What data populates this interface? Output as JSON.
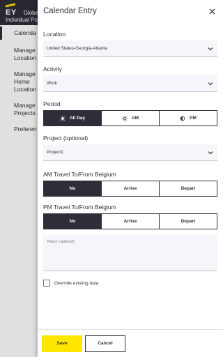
{
  "background": {
    "logo": "EY",
    "app_title": "Global",
    "subtitle": "Individual Po",
    "nav": [
      {
        "label": "Calenda",
        "active": true
      },
      {
        "label": "Manage Location",
        "active": false
      },
      {
        "label": "Manage Home Location",
        "active": false
      },
      {
        "label": "Manage Projects",
        "active": false
      },
      {
        "label": "Preferen",
        "active": false
      }
    ]
  },
  "drawer": {
    "title": "Calendar Entry",
    "close_icon": "close-icon",
    "location": {
      "label": "Location",
      "value": "United States-Georgia-Atlanta"
    },
    "activity": {
      "label": "Activity",
      "value": "Work"
    },
    "period": {
      "label": "Period",
      "options": [
        {
          "label": "All Day",
          "icon": "sun-full-icon",
          "selected": true
        },
        {
          "label": "AM",
          "icon": "sun-icon",
          "selected": false
        },
        {
          "label": "PM",
          "icon": "half-moon-icon",
          "selected": false
        }
      ]
    },
    "project": {
      "label": "Project (optional)",
      "value": "Project1"
    },
    "am_travel": {
      "label": "AM Travel To/From Belgium",
      "options": [
        {
          "label": "No",
          "selected": true
        },
        {
          "label": "Arrive",
          "selected": false
        },
        {
          "label": "Depart",
          "selected": false
        }
      ]
    },
    "pm_travel": {
      "label": "PM Travel To/From Belgium",
      "options": [
        {
          "label": "No",
          "selected": true
        },
        {
          "label": "Arrive",
          "selected": false
        },
        {
          "label": "Depart",
          "selected": false
        }
      ]
    },
    "notes": {
      "placeholder": "Notes (optional)",
      "value": ""
    },
    "override": {
      "label": "Override existing data",
      "checked": false
    },
    "save_label": "Save",
    "cancel_label": "Cancel"
  },
  "colors": {
    "accent": "#ffe600",
    "dark": "#2e2e38"
  }
}
